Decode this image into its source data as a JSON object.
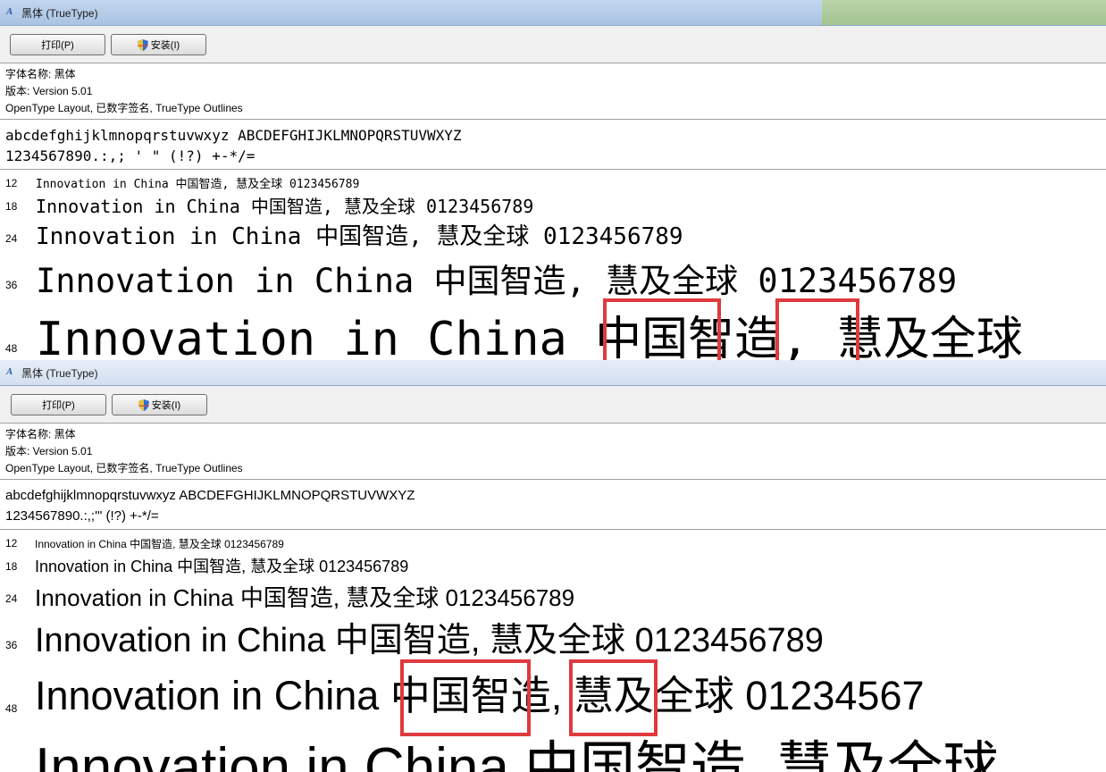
{
  "window_top": {
    "title": "黑体 (TrueType)",
    "print_button": "打印(P)",
    "install_button": "安装(I)",
    "font_name": "字体名称: 黑体",
    "version": "版本: Version 5.01",
    "type_info": "OpenType Layout, 已数字签名, TrueType Outlines",
    "alphabet": "abcdefghijklmnopqrstuvwxyz ABCDEFGHIJKLMNOPQRSTUVWXYZ",
    "digits": "1234567890.:,; ' \" (!?) +-*/=",
    "sizes": [
      {
        "size": "12",
        "text": "Innovation in China 中国智造, 慧及全球 0123456789"
      },
      {
        "size": "18",
        "text": "Innovation in China 中国智造, 慧及全球 0123456789"
      },
      {
        "size": "24",
        "text": "Innovation in China 中国智造, 慧及全球 0123456789"
      },
      {
        "size": "36",
        "text": "Innovation in China 中国智造, 慧及全球 0123456789"
      },
      {
        "size": "48",
        "text": "Innovation in China 中国智造, 慧及全球"
      }
    ]
  },
  "window_bottom": {
    "title": "黑体 (TrueType)",
    "print_button": "打印(P)",
    "install_button": "安装(I)",
    "font_name": "字体名称: 黑体",
    "version": "版本: Version 5.01",
    "type_info": "OpenType Layout, 已数字签名, TrueType Outlines",
    "alphabet": "abcdefghijklmnopqrstuvwxyz ABCDEFGHIJKLMNOPQRSTUVWXYZ",
    "digits": "1234567890.:,;'\" (!?) +-*/=",
    "sizes": [
      {
        "size": "12",
        "text": "Innovation in China 中国智造, 慧及全球 0123456789"
      },
      {
        "size": "18",
        "text": "Innovation in China 中国智造, 慧及全球 0123456789"
      },
      {
        "size": "24",
        "text": "Innovation in China 中国智造, 慧及全球 0123456789"
      },
      {
        "size": "36",
        "text": "Innovation in China 中国智造, 慧及全球 0123456789"
      },
      {
        "size": "48",
        "text": "Innovation in China 中国智造, 慧及全球 01234567"
      },
      {
        "size": "",
        "text": "Innovation in China 中国智造, 慧及全球"
      }
    ]
  },
  "colors": {
    "highlight": "#e03a3e",
    "titlebar": "#a9c3e3",
    "toolbar": "#f0f0f0"
  },
  "icons": {
    "app": "font-app-icon",
    "install": "uac-shield-icon"
  }
}
